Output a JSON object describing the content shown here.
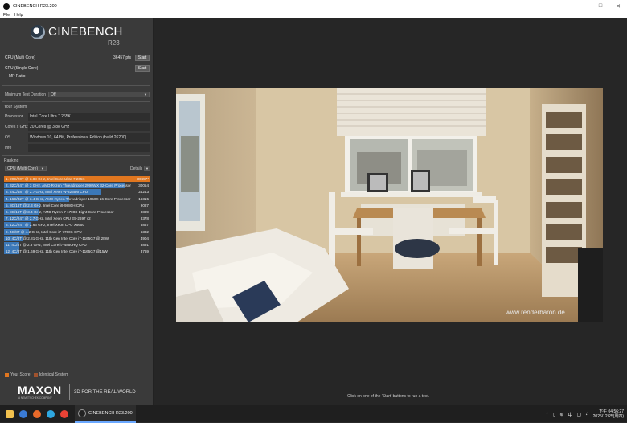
{
  "window": {
    "title": "CINEBENCH R23.200",
    "menu": [
      "File",
      "Help"
    ]
  },
  "logo": {
    "name": "CINEBENCH",
    "version": "R23"
  },
  "tests": {
    "multi": {
      "label": "CPU (Multi Core)",
      "value": "36457 pts",
      "button": "Start"
    },
    "single": {
      "label": "CPU (Single Core)",
      "value": "---",
      "button": "Start"
    },
    "mp": {
      "label": "MP Ratio",
      "value": "---"
    }
  },
  "duration": {
    "label": "Minimum Test Duration",
    "value": "Off"
  },
  "system": {
    "heading": "Your System",
    "processor": {
      "label": "Processor",
      "value": "Intel Core Ultra 7 265K"
    },
    "cores": {
      "label": "Cores x GHz",
      "value": "20 Cores @ 3.88 GHz"
    },
    "os": {
      "label": "OS",
      "value": "Windows 10, 64 Bit, Professional Edition (build 26200)"
    },
    "info": {
      "label": "Info",
      "value": ""
    }
  },
  "ranking": {
    "heading": "Ranking",
    "selector": "CPU (Multi Core)",
    "details": "Details",
    "max_score": 36457,
    "items": [
      {
        "text": "1. 20C/20T @ 3.88 GHz, Intel Core Ultra 7 265K",
        "score": "36457*",
        "value": 36457,
        "mine": true
      },
      {
        "text": "2. 32C/64T @ 3 GHz, AMD Ryzen Threadripper 2990WX 32-Core Processor",
        "score": "30054",
        "value": 30054,
        "mine": false
      },
      {
        "text": "3. 24C/48T @ 2.7 GHz, Intel Xeon W-3265M CPU",
        "score": "24243",
        "value": 24243,
        "mine": false
      },
      {
        "text": "4. 16C/32T @ 3.4 GHz, AMD Ryzen Threadripper 1950X 16-Core Processor",
        "score": "16315",
        "value": 16315,
        "mine": false
      },
      {
        "text": "5. 8C/16T @ 2.3 GHz, Intel Core i9-9880H CPU",
        "score": "9087",
        "value": 9087,
        "mine": false
      },
      {
        "text": "6. 8C/16T @ 3.4 GHz, AMD Ryzen 7 1700X Eight-Core Processor",
        "score": "8889",
        "value": 8889,
        "mine": false
      },
      {
        "text": "7. 12C/24T @ 2.7 GHz, Intel Xeon CPU E5-2697 v2",
        "score": "8378",
        "value": 8378,
        "mine": false
      },
      {
        "text": "8. 12C/24T @ 2.66 GHz, Intel Xeon CPU X5650",
        "score": "6867",
        "value": 6867,
        "mine": false
      },
      {
        "text": "9. 4C/8T @ 4.2 GHz, Intel Core i7-7700K CPU",
        "score": "6302",
        "value": 6302,
        "mine": false
      },
      {
        "text": "10. 4C/8T @ 2.81 GHz, 11th Gen Intel Core i7-1165G7 @ 28W",
        "score": "4904",
        "value": 4904,
        "mine": false
      },
      {
        "text": "11. 4C/8T @ 2.3 GHz, Intel Core i7-4850HQ CPU",
        "score": "3891",
        "value": 3891,
        "mine": false
      },
      {
        "text": "12. 4C/8T @ 1.69 GHz, 11th Gen Intel Core i7-1165G7 @15W",
        "score": "3769",
        "value": 3769,
        "mine": false
      }
    ]
  },
  "legend": {
    "your": "Your Score",
    "identical": "Identical System"
  },
  "brand": {
    "name": "MAXON",
    "sub": "A NEMETSCHEK COMPANY",
    "tagline": "3D FOR THE REAL WORLD"
  },
  "render": {
    "watermark": "www.renderbaron.de"
  },
  "hint": "Click on one of the 'Start' buttons to run a test.",
  "taskbar": {
    "app": "CINEBENCH R23.200",
    "time": "04:56:27",
    "date": "2025/12/25(周四)",
    "ime": "中",
    "lang": "下午"
  },
  "colors": {
    "accent": "#e0761f",
    "bar": "#3b78b8",
    "bar_light": "#4a8bd0"
  }
}
